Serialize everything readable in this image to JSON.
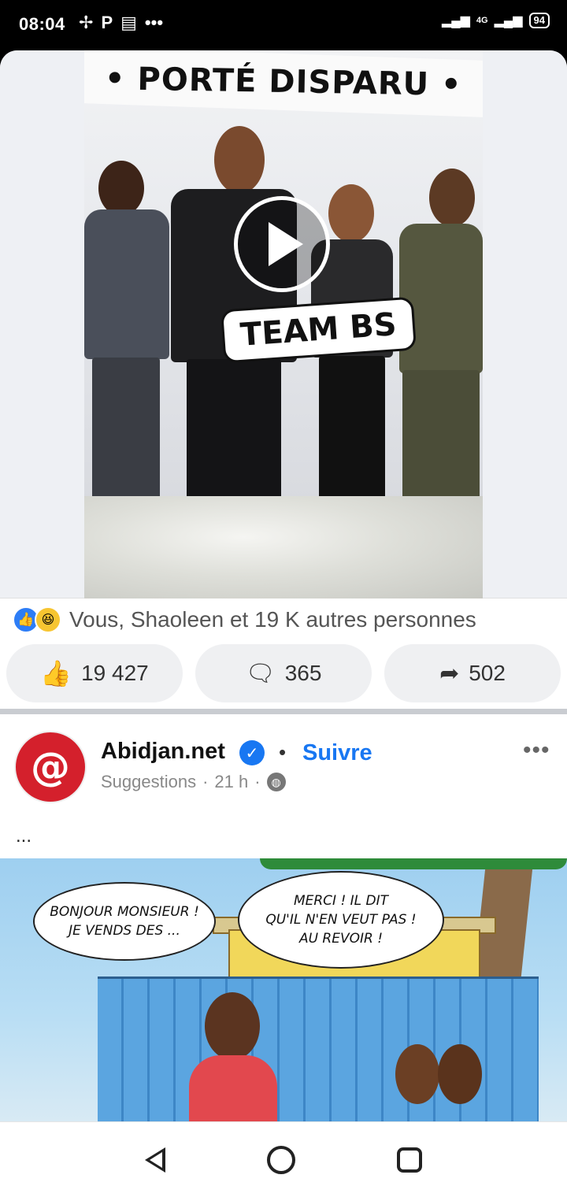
{
  "status_bar": {
    "time": "08:04",
    "left_icons": [
      "pinwheel-icon",
      "parking-p-icon",
      "news-icon",
      "more-dots-icon"
    ],
    "network": "4G",
    "battery": "94"
  },
  "video_post": {
    "banner_title": "• PORTÉ DISPARU •",
    "overlay_label": "TEAM BS",
    "reactions_text": "Vous, Shaoleen et 19 K autres personnes",
    "like_count": "19 427",
    "comment_count": "365",
    "share_count": "502"
  },
  "suggested_post": {
    "page_name": "Abidjan.net",
    "follow_label": "Suivre",
    "separator": "•",
    "subtitle": "Suggestions",
    "time": "21 h",
    "text": "...",
    "cartoon": {
      "bubble_left": "BONJOUR MONSIEUR !\nJE VENDS DES ...",
      "bubble_right": "MERCI ! IL DIT\nQU'IL N'EN VEUT PAS !\nAU REVOIR !"
    }
  },
  "colors": {
    "facebook_blue": "#1877f2",
    "avatar_red": "#d4202c"
  },
  "nav_bar": {
    "icons": [
      "back-icon",
      "home-icon",
      "recents-icon"
    ]
  }
}
